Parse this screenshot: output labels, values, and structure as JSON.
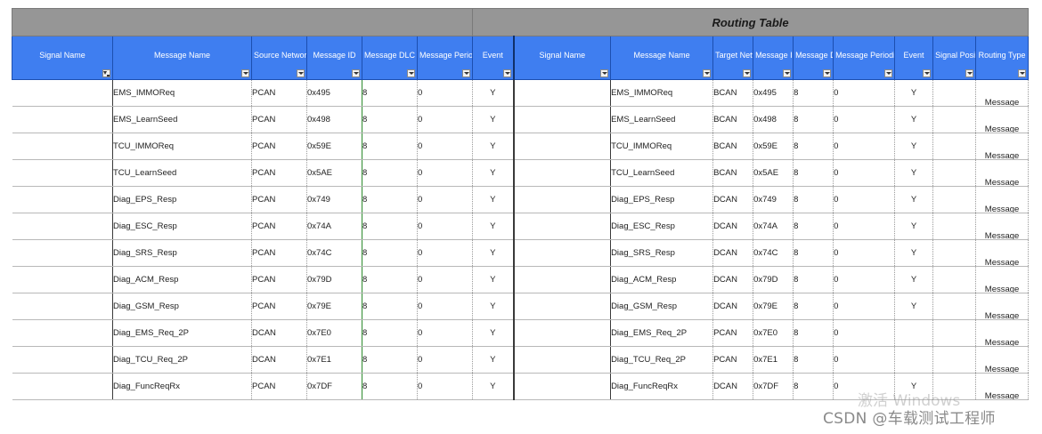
{
  "table_title": "Routing Table",
  "headers": [
    {
      "label": "Signal Name",
      "filter": true
    },
    {
      "label": "Message Name"
    },
    {
      "label": "Source Network"
    },
    {
      "label": "Message ID"
    },
    {
      "label": "Message DLC"
    },
    {
      "label": "Message Periodic (ms)"
    },
    {
      "label": "Event"
    },
    {
      "label": "Signal Name"
    },
    {
      "label": "Message Name"
    },
    {
      "label": "Target Network"
    },
    {
      "label": "Message ID"
    },
    {
      "label": "Message DLC"
    },
    {
      "label": "Message Periodic (ms)"
    },
    {
      "label": "Event"
    },
    {
      "label": "Signal Position"
    },
    {
      "label": "Routing Type"
    }
  ],
  "rows": [
    [
      "",
      "EMS_IMMOReq",
      "PCAN",
      "0x495",
      "8",
      "0",
      "Y",
      "",
      "EMS_IMMOReq",
      "BCAN",
      "0x495",
      "8",
      "0",
      "Y",
      "",
      "Message"
    ],
    [
      "",
      "EMS_LearnSeed",
      "PCAN",
      "0x498",
      "8",
      "0",
      "Y",
      "",
      "EMS_LearnSeed",
      "BCAN",
      "0x498",
      "8",
      "0",
      "Y",
      "",
      "Message"
    ],
    [
      "",
      "TCU_IMMOReq",
      "PCAN",
      "0x59E",
      "8",
      "0",
      "Y",
      "",
      "TCU_IMMOReq",
      "BCAN",
      "0x59E",
      "8",
      "0",
      "Y",
      "",
      "Message"
    ],
    [
      "",
      "TCU_LearnSeed",
      "PCAN",
      "0x5AE",
      "8",
      "0",
      "Y",
      "",
      "TCU_LearnSeed",
      "BCAN",
      "0x5AE",
      "8",
      "0",
      "Y",
      "",
      "Message"
    ],
    [
      "",
      "Diag_EPS_Resp",
      "PCAN",
      "0x749",
      "8",
      "0",
      "Y",
      "",
      "Diag_EPS_Resp",
      "DCAN",
      "0x749",
      "8",
      "0",
      "Y",
      "",
      "Message"
    ],
    [
      "",
      "Diag_ESC_Resp",
      "PCAN",
      "0x74A",
      "8",
      "0",
      "Y",
      "",
      "Diag_ESC_Resp",
      "DCAN",
      "0x74A",
      "8",
      "0",
      "Y",
      "",
      "Message"
    ],
    [
      "",
      "Diag_SRS_Resp",
      "PCAN",
      "0x74C",
      "8",
      "0",
      "Y",
      "",
      "Diag_SRS_Resp",
      "DCAN",
      "0x74C",
      "8",
      "0",
      "Y",
      "",
      "Message"
    ],
    [
      "",
      "Diag_ACM_Resp",
      "PCAN",
      "0x79D",
      "8",
      "0",
      "Y",
      "",
      "Diag_ACM_Resp",
      "DCAN",
      "0x79D",
      "8",
      "0",
      "Y",
      "",
      "Message"
    ],
    [
      "",
      "Diag_GSM_Resp",
      "PCAN",
      "0x79E",
      "8",
      "0",
      "Y",
      "",
      "Diag_GSM_Resp",
      "DCAN",
      "0x79E",
      "8",
      "0",
      "Y",
      "",
      "Message"
    ],
    [
      "",
      "Diag_EMS_Req_2P",
      "DCAN",
      "0x7E0",
      "8",
      "0",
      "Y",
      "",
      "Diag_EMS_Req_2P",
      "PCAN",
      "0x7E0",
      "8",
      "0",
      "",
      "",
      "Message"
    ],
    [
      "",
      "Diag_TCU_Req_2P",
      "DCAN",
      "0x7E1",
      "8",
      "0",
      "Y",
      "",
      "Diag_TCU_Req_2P",
      "PCAN",
      "0x7E1",
      "8",
      "0",
      "",
      "",
      "Message"
    ],
    [
      "",
      "Diag_FuncReqRx",
      "PCAN",
      "0x7DF",
      "8",
      "0",
      "Y",
      "",
      "Diag_FuncReqRx",
      "DCAN",
      "0x7DF",
      "8",
      "0",
      "Y",
      "",
      "Message"
    ]
  ],
  "watermark_windows": "激活 Windows",
  "watermark_csdn": "CSDN @车载测试工程师"
}
